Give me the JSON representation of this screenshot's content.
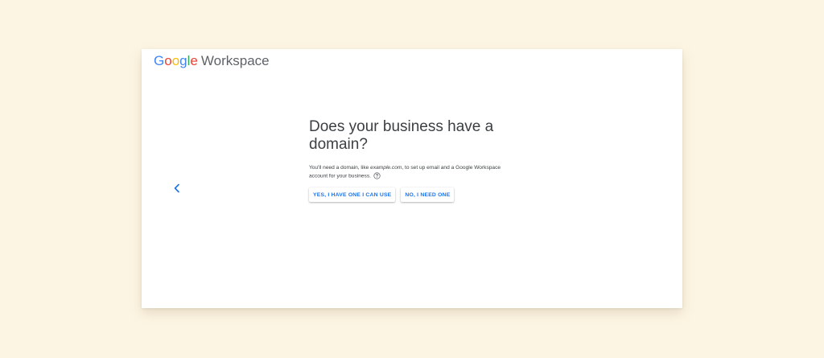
{
  "logo": {
    "brand_letters": [
      {
        "char": "G",
        "color": "#4285f4"
      },
      {
        "char": "o",
        "color": "#ea4335"
      },
      {
        "char": "o",
        "color": "#fbbc05"
      },
      {
        "char": "g",
        "color": "#4285f4"
      },
      {
        "char": "l",
        "color": "#34a853"
      },
      {
        "char": "e",
        "color": "#ea4335"
      }
    ],
    "product": "Workspace"
  },
  "nav": {
    "back_icon": "chevron-left-icon"
  },
  "main": {
    "title": "Does your business have a domain?",
    "desc_before": "You'll need a domain, like ",
    "desc_example": "example.com",
    "desc_after": ", to set up email and a Google Workspace account for your business.",
    "help_icon": "help-circle-icon",
    "yes_button": "YES, I HAVE ONE I CAN USE",
    "no_button": "NO, I NEED ONE"
  },
  "colors": {
    "background": "#fdf5e3",
    "accent": "#1a73e8",
    "text": "#3c4043"
  }
}
